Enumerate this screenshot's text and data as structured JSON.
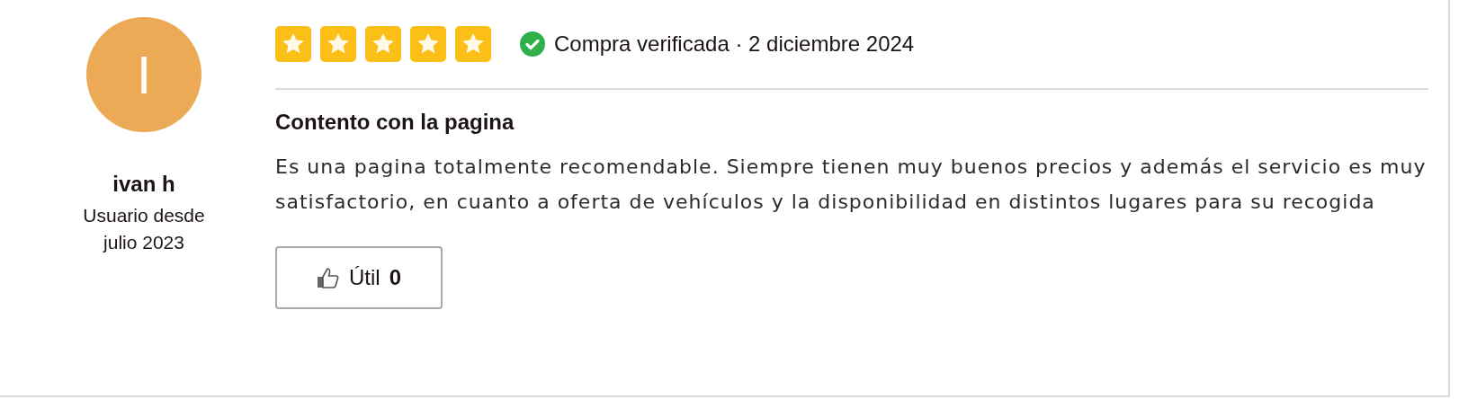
{
  "reviewer": {
    "initial": "I",
    "name": "ivan h",
    "member_since": "Usuario desde julio 2023"
  },
  "review": {
    "stars": 5,
    "verified": true,
    "meta": "Compra verificada · 2 diciembre 2024",
    "title": "Contento con la pagina",
    "body": "Es una pagina totalmente recomendable. Siempre tienen muy buenos precios y además el servicio es muy satisfactorio, en cuanto a oferta de vehículos y la disponibilidad en distintos lugares para su recogida"
  },
  "helpful_button": {
    "label": "Útil",
    "count": "0"
  }
}
